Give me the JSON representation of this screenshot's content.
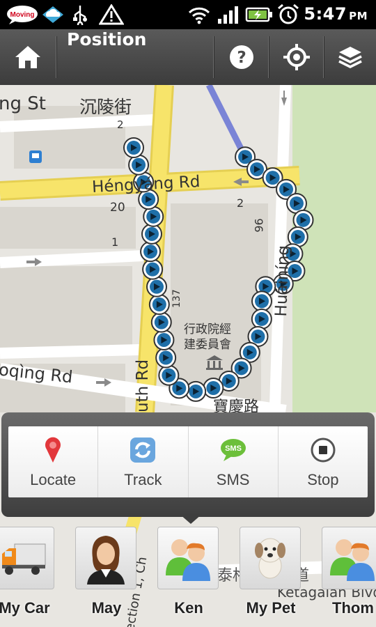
{
  "status_bar": {
    "notifications": [
      "moving-app-icon",
      "cloud-sync-icon",
      "usb-icon",
      "warning-icon"
    ],
    "system": [
      "wifi-icon",
      "signal-icon",
      "battery-charging-icon",
      "alarm-icon"
    ],
    "time": "5:47",
    "ampm": "PM"
  },
  "action_bar": {
    "title": "Position",
    "home_icon": "home-icon",
    "help_icon": "help-icon",
    "locate_icon": "gps-target-icon",
    "layers_icon": "layers-icon"
  },
  "map": {
    "labels": {
      "st": "ng St",
      "chinese_street": "沉陵街",
      "num_2a": "2",
      "hengyang": "Héngyáng Rd",
      "num_20": "20",
      "num_2b": "2",
      "num_96": "96",
      "num_1": "1",
      "huaining": "Huáiníng",
      "gov_building": "行政院經\n建委員會",
      "baoqing": "oqìng Rd",
      "south_rd": "uth Rd",
      "num_137": "137",
      "baoqing_cn": "寶慶路",
      "section": "ection 1, Ch",
      "ketagalan_cn": "泰格達蘭大道",
      "ketagalan": "Ketagalan Blvd"
    },
    "track_point_count": 34
  },
  "popup": {
    "actions": [
      {
        "label": "Locate",
        "icon": "map-pin-icon"
      },
      {
        "label": "Track",
        "icon": "refresh-arrows-icon"
      },
      {
        "label": "SMS",
        "icon": "sms-bubble-icon"
      },
      {
        "label": "Stop",
        "icon": "stop-icon"
      }
    ]
  },
  "contacts": [
    {
      "name": "My Car",
      "icon": "truck-icon"
    },
    {
      "name": "May",
      "icon": "woman-avatar-icon"
    },
    {
      "name": "Ken",
      "icon": "group-avatar-icon",
      "selected": true
    },
    {
      "name": "My Pet",
      "icon": "dog-icon"
    },
    {
      "name": "Thom",
      "icon": "group-avatar-icon"
    }
  ],
  "colors": {
    "route": "#7a84d6",
    "track_point": "#1f6fa8",
    "road_yellow": "#f7e46a",
    "park_green": "#cfe3b8"
  }
}
